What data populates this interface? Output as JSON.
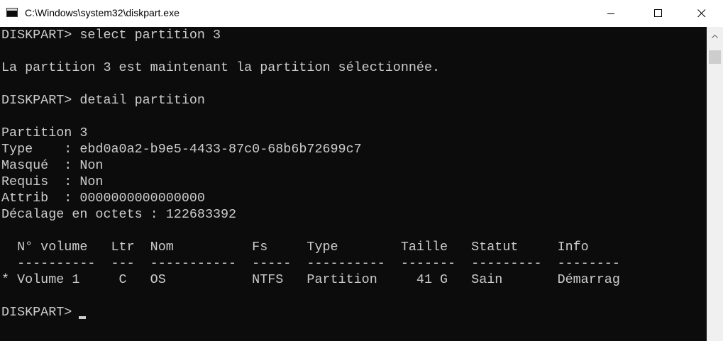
{
  "window": {
    "title": "C:\\Windows\\system32\\diskpart.exe",
    "icons": {
      "app": "console-icon",
      "minimize": "minimize-icon",
      "maximize": "maximize-icon",
      "close": "close-icon"
    }
  },
  "console": {
    "lines": [
      "DISKPART> select partition 3",
      "",
      "La partition 3 est maintenant la partition sélectionnée.",
      "",
      "DISKPART> detail partition",
      "",
      "Partition 3",
      "Type    : ebd0a0a2-b9e5-4433-87c0-68b6b72699c7",
      "Masqué  : Non",
      "Requis  : Non",
      "Attrib  : 0000000000000000",
      "Décalage en octets : 122683392",
      "",
      "  N° volume   Ltr  Nom          Fs     Type        Taille   Statut     Info",
      "  ----------  ---  -----------  -----  ----------  -------  ---------  --------",
      "* Volume 1     C   OS           NTFS   Partition     41 G   Sain       Démarrag",
      "",
      "DISKPART> "
    ]
  },
  "colors": {
    "background": "#0c0c0c",
    "text": "#cccccc",
    "titlebar": "#ffffff",
    "scrollbar": "#f0f0f0"
  }
}
